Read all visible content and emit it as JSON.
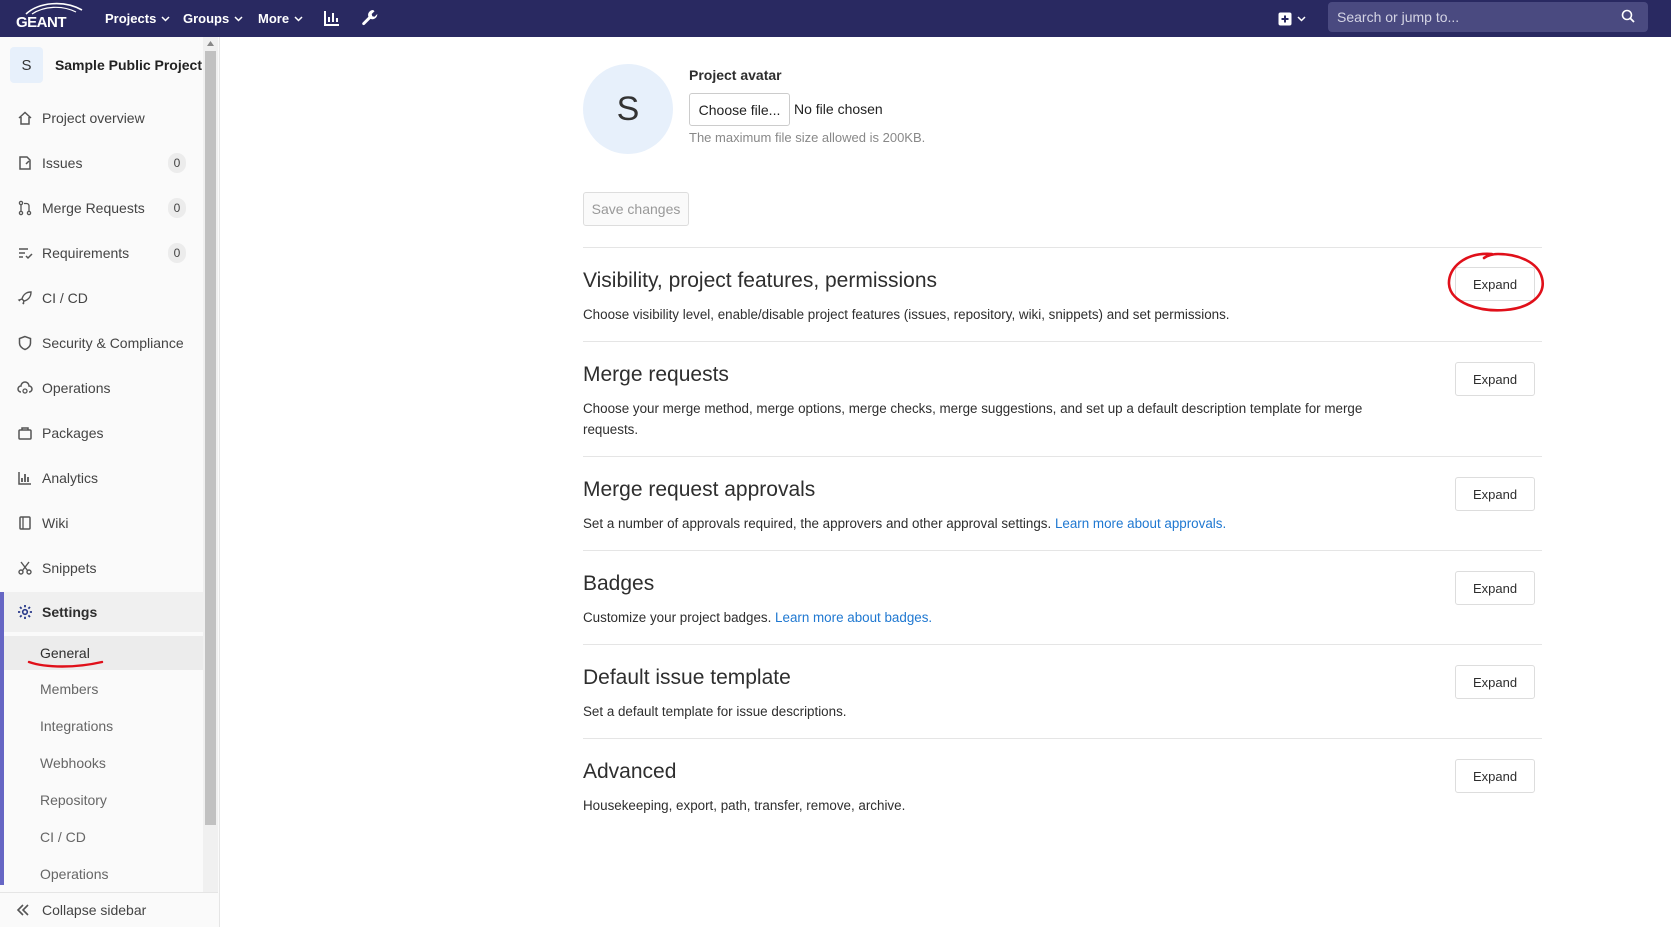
{
  "topbar": {
    "logo_text": "GEANT",
    "nav": [
      {
        "label": "Projects"
      },
      {
        "label": "Groups"
      },
      {
        "label": "More"
      }
    ],
    "search_placeholder": "Search or jump to..."
  },
  "sidebar": {
    "project_initial": "S",
    "project_name": "Sample Public Project",
    "items": [
      {
        "label": "Project overview"
      },
      {
        "label": "Issues",
        "count": "0"
      },
      {
        "label": "Merge Requests",
        "count": "0"
      },
      {
        "label": "Requirements",
        "count": "0"
      },
      {
        "label": "CI / CD"
      },
      {
        "label": "Security & Compliance"
      },
      {
        "label": "Operations"
      },
      {
        "label": "Packages"
      },
      {
        "label": "Analytics"
      },
      {
        "label": "Wiki"
      },
      {
        "label": "Snippets"
      },
      {
        "label": "Settings"
      }
    ],
    "settings_sub": [
      {
        "label": "General"
      },
      {
        "label": "Members"
      },
      {
        "label": "Integrations"
      },
      {
        "label": "Webhooks"
      },
      {
        "label": "Repository"
      },
      {
        "label": "CI / CD"
      },
      {
        "label": "Operations"
      }
    ],
    "collapse_label": "Collapse sidebar"
  },
  "avatar": {
    "initial": "S",
    "label": "Project avatar",
    "choose_button": "Choose file...",
    "no_file": "No file chosen",
    "hint": "The maximum file size allowed is 200KB."
  },
  "save_button": "Save changes",
  "sections": [
    {
      "title": "Visibility, project features, permissions",
      "description": "Choose visibility level, enable/disable project features (issues, repository, wiki, snippets) and set permissions.",
      "button": "Expand"
    },
    {
      "title": "Merge requests",
      "description": "Choose your merge method, merge options, merge checks, merge suggestions, and set up a default description template for merge requests.",
      "button": "Expand"
    },
    {
      "title": "Merge request approvals",
      "description": "Set a number of approvals required, the approvers and other approval settings.",
      "link": "Learn more about approvals.",
      "button": "Expand"
    },
    {
      "title": "Badges",
      "description": "Customize your project badges.",
      "link": "Learn more about badges.",
      "button": "Expand"
    },
    {
      "title": "Default issue template",
      "description": "Set a default template for issue descriptions.",
      "button": "Expand"
    },
    {
      "title": "Advanced",
      "description": "Housekeeping, export, path, transfer, remove, archive.",
      "button": "Expand"
    }
  ],
  "colors": {
    "topbar": "#292961",
    "link": "#1f78d1",
    "annotation": "#e0101a",
    "active_border": "#6666c4"
  }
}
